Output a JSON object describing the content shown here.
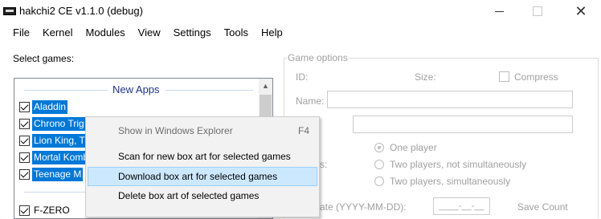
{
  "window": {
    "title": "hakchi2 CE v1.1.0 (debug)",
    "minimize_symbol": "",
    "close_symbol": "✕"
  },
  "menu": [
    "File",
    "Kernel",
    "Modules",
    "View",
    "Settings",
    "Tools",
    "Help"
  ],
  "left": {
    "select_games_label": "Select games:",
    "group1_title": "New Apps",
    "games_selected": [
      "Aladdin",
      "Chrono Trig",
      "Lion King, T",
      "Mortal Komb",
      "Teenage M"
    ],
    "games_other": [
      "F-ZERO"
    ],
    "scroll_up_symbol": "▲"
  },
  "game_options": {
    "group_title": "Game options",
    "id_label": "ID:",
    "size_label": "Size:",
    "compress_label": "Compress",
    "name_label": "Name:",
    "players_label_partial": "s:",
    "one_player": "One player",
    "two_players_not_sim": "Two players, not simultaneously",
    "two_players_sim": "Two players, simultaneously",
    "release_date_label": "ate (YYYY-MM-DD):",
    "date_placeholder": "____-__-__",
    "save_count_label": "Save Count"
  },
  "context_menu": {
    "items": [
      {
        "label": "Show in Windows Explorer",
        "shortcut": "F4",
        "enabled": false
      },
      {
        "label": "Scan for new box art for selected games",
        "shortcut": "",
        "enabled": true
      },
      {
        "label": "Download box art for selected games",
        "shortcut": "",
        "enabled": true,
        "highlighted": true
      },
      {
        "label": "Delete box art of selected games",
        "shortcut": "",
        "enabled": true
      }
    ]
  },
  "colors": {
    "selection": "#0078d7",
    "group_header_text": "#1e3287",
    "menu_highlight": "#cce8ff",
    "disabled_text": "#a0a0a0"
  }
}
